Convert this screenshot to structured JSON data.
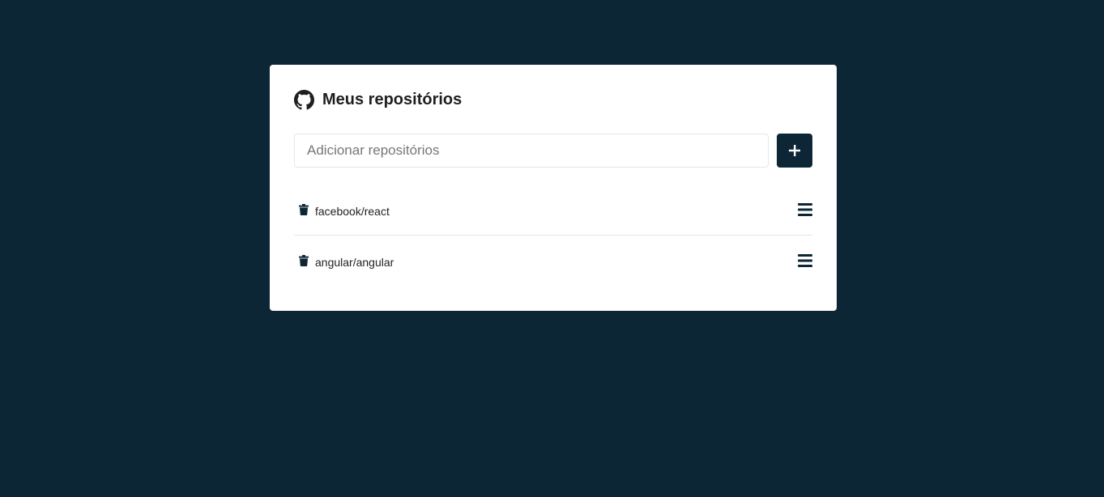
{
  "header": {
    "icon": "github-icon",
    "title": "Meus repositórios"
  },
  "form": {
    "placeholder": "Adicionar repositórios",
    "value": "",
    "add_icon": "plus-icon"
  },
  "repositories": [
    {
      "name": "facebook/react",
      "delete_icon": "trash-icon",
      "detail_icon": "bars-icon"
    },
    {
      "name": "angular/angular",
      "delete_icon": "trash-icon",
      "detail_icon": "bars-icon"
    }
  ],
  "colors": {
    "background": "#0d2636",
    "card": "#ffffff",
    "accent": "#0d2636"
  }
}
